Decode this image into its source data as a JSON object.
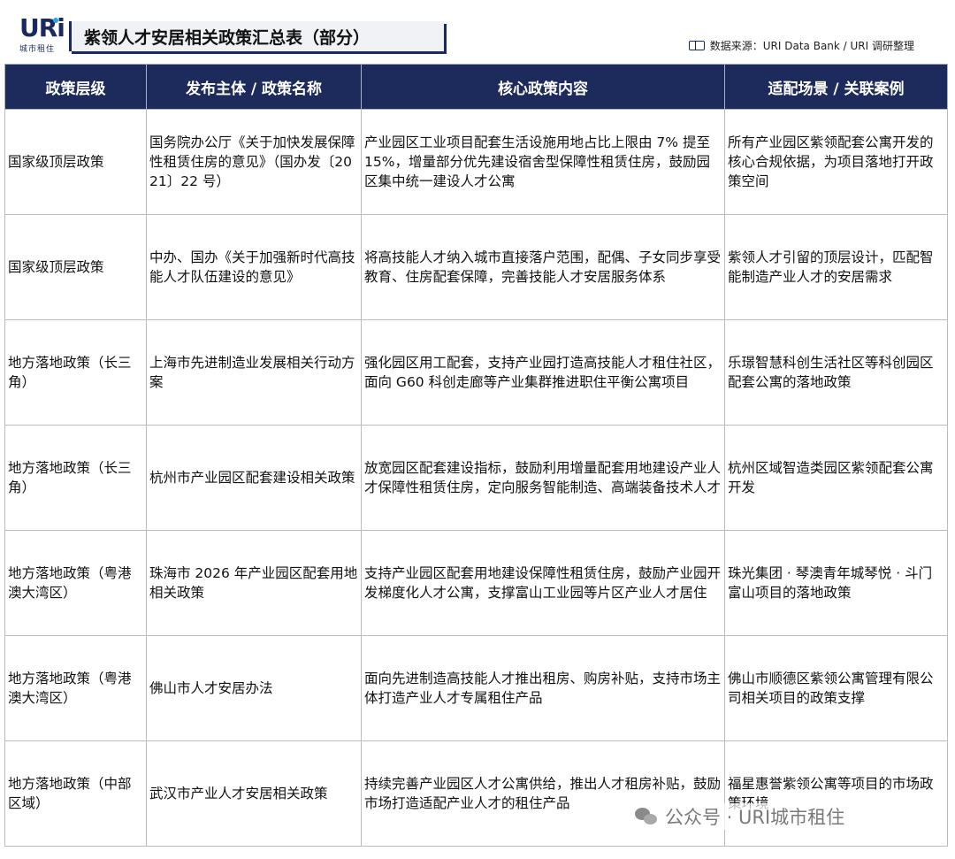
{
  "logo": {
    "mark": "URi",
    "sub": "城市租住"
  },
  "title": "紫领人才安居相关政策汇总表（部分）",
  "source": "数据来源：URI Data Bank / URI 调研整理",
  "table": {
    "headers": [
      "政策层级",
      "发布主体 / 政策名称",
      "核心政策内容",
      "适配场景 / 关联案例"
    ],
    "rows": [
      [
        "国家级顶层政策",
        "国务院办公厅《关于加快发展保障性租赁住房的意见》（国办发〔2021〕22 号）",
        "产业园区工业项目配套生活设施用地占比上限由 7% 提至 15%，增量部分优先建设宿舍型保障性租赁住房，鼓励园区集中统一建设人才公寓",
        "所有产业园区紫领配套公寓开发的核心合规依据，为项目落地打开政策空间"
      ],
      [
        "国家级顶层政策",
        "中办、国办《关于加强新时代高技能人才队伍建设的意见》",
        "将高技能人才纳入城市直接落户范围，配偶、子女同步享受教育、住房配套保障，完善技能人才安居服务体系",
        "紫领人才引留的顶层设计，匹配智能制造产业人才的安居需求"
      ],
      [
        "地方落地政策（长三角）",
        "上海市先进制造业发展相关行动方案",
        "强化园区用工配套，支持产业园打造高技能人才租住社区，面向 G60 科创走廊等产业集群推进职住平衡公寓项目",
        "乐璟智慧科创生活社区等科创园区配套公寓的落地政策"
      ],
      [
        "地方落地政策（长三角）",
        "杭州市产业园区配套建设相关政策",
        "放宽园区配套建设指标，鼓励利用增量配套用地建设产业人才保障性租赁住房，定向服务智能制造、高端装备技术人才",
        "杭州区域智造类园区紫领配套公寓开发"
      ],
      [
        "地方落地政策（粤港澳大湾区）",
        "珠海市 2026 年产业园区配套用地相关政策",
        "支持产业园区配套用地建设保障性租赁住房，鼓励产业园开发梯度化人才公寓，支撑富山工业园等片区产业人才居住",
        "珠光集团 · 琴澳青年城琴悦 · 斗门富山项目的落地政策"
      ],
      [
        "地方落地政策（粤港澳大湾区）",
        "佛山市人才安居办法",
        "面向先进制造高技能人才推出租房、购房补贴，支持市场主体打造产业人才专属租住产品",
        "佛山市顺德区紫领公寓管理有限公司相关项目的政策支撑"
      ],
      [
        "地方落地政策（中部区域）",
        "武汉市产业人才安居相关政策",
        "持续完善产业园区人才公寓供给，推出人才租房补贴，鼓励市场打造适配产业人才的租住产品",
        "福星惠誉紫领公寓等项目的市场政策环境"
      ]
    ]
  },
  "watermark": "公众号 · URI城市租住",
  "colors": {
    "header_bg": "#1c2b5c",
    "brand": "#1b2a5e",
    "accent": "#2aa6e0"
  }
}
